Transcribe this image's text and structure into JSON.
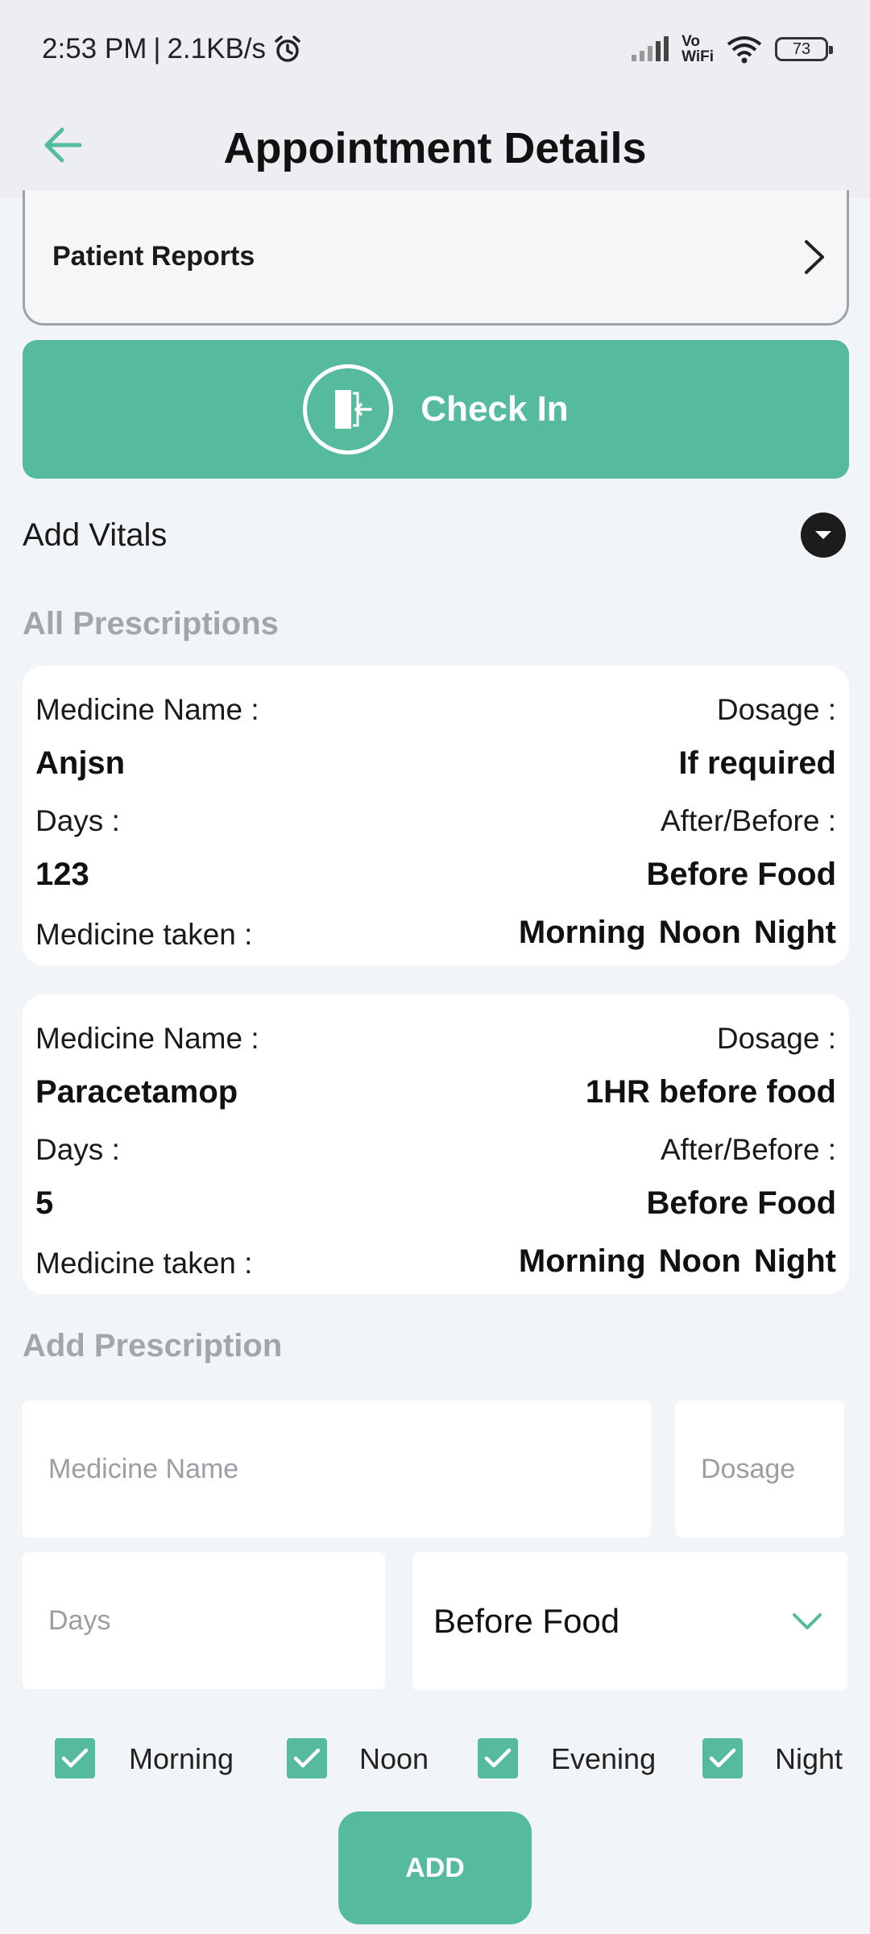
{
  "status_bar": {
    "time": "2:53 PM",
    "separator": "|",
    "speed": "2.1KB/s",
    "vo": "Vo",
    "wifi": "WiFi",
    "battery": "73"
  },
  "header": {
    "title": "Appointment Details"
  },
  "reports": {
    "label": "Patient Reports"
  },
  "checkin": {
    "label": "Check In"
  },
  "vitals": {
    "label": "Add Vitals"
  },
  "all_prescriptions": {
    "title": "All Prescriptions",
    "items": [
      {
        "medicine_label": "Medicine Name :",
        "medicine": "Anjsn",
        "dosage_label": "Dosage :",
        "dosage": "If required",
        "days_label": "Days :",
        "days": "123",
        "after_label": "After/Before :",
        "after": "Before Food",
        "taken_label": "Medicine taken :",
        "taken": [
          "Morning",
          "Noon",
          "Night"
        ]
      },
      {
        "medicine_label": "Medicine Name :",
        "medicine": "Paracetamop",
        "dosage_label": "Dosage :",
        "dosage": "1HR before food",
        "days_label": "Days :",
        "days": "5",
        "after_label": "After/Before :",
        "after": "Before Food",
        "taken_label": "Medicine taken :",
        "taken": [
          "Morning",
          "Noon",
          "Night"
        ]
      }
    ]
  },
  "add_prescription": {
    "title": "Add Prescription",
    "medicine_placeholder": "Medicine Name",
    "dosage_placeholder": "Dosage",
    "days_placeholder": "Days",
    "timing_value": "Before Food",
    "checkboxes": [
      {
        "label": "Morning",
        "checked": true
      },
      {
        "label": "Noon",
        "checked": true
      },
      {
        "label": "Evening",
        "checked": true
      },
      {
        "label": "Night",
        "checked": true
      }
    ],
    "add_label": "ADD"
  },
  "colors": {
    "accent": "#56ba9c",
    "header_bg": "#eceef2",
    "page_bg": "#f2f5f7",
    "muted": "#a3a6a9"
  }
}
